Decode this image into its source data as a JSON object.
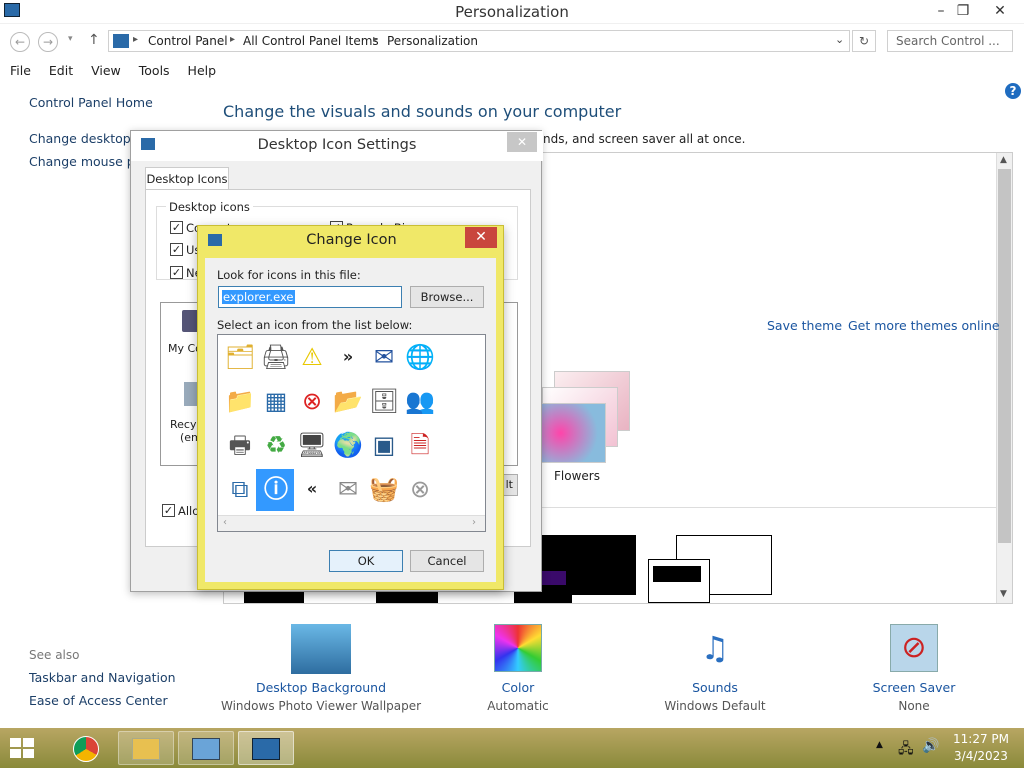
{
  "window": {
    "title": "Personalization"
  },
  "address": {
    "crumbs": [
      "Control Panel",
      "All Control Panel Items",
      "Personalization"
    ],
    "search_placeholder": "Search Control ..."
  },
  "menu": [
    "File",
    "Edit",
    "View",
    "Tools",
    "Help"
  ],
  "left_nav": {
    "home": "Control Panel Home",
    "desktop_icons": "Change desktop icons",
    "mouse_pointers": "Change mouse pointers",
    "see_also": "See also",
    "taskbar": "Taskbar and Navigation",
    "ease": "Ease of Access Center"
  },
  "main": {
    "heading": "Change the visuals and sounds on your computer",
    "subtext": "nds, and screen saver all at once.",
    "save_theme": "Save theme",
    "get_more": "Get more themes online",
    "flowers": "Flowers"
  },
  "bottom": [
    {
      "label": "Desktop Background",
      "value": "Windows Photo Viewer Wallpaper"
    },
    {
      "label": "Color",
      "value": "Automatic"
    },
    {
      "label": "Sounds",
      "value": "Windows Default"
    },
    {
      "label": "Screen Saver",
      "value": "None"
    }
  ],
  "dis": {
    "title": "Desktop Icon Settings",
    "tab": "Desktop Icons",
    "group": "Desktop icons",
    "computer": "Computer",
    "recycle": "Recycle Bin",
    "user": "Use",
    "network": "Ne",
    "mycomp": "My Com",
    "recycle_empty": "Recyc",
    "empty": "(em",
    "allow": "Allow"
  },
  "ci": {
    "title": "Change Icon",
    "look_label": "Look for icons in this file:",
    "file_value": "explorer.exe",
    "browse": "Browse...",
    "select_label": "Select an icon from the list below:",
    "ok": "OK",
    "cancel": "Cancel"
  },
  "clock": {
    "time": "11:27 PM",
    "date": "3/4/2023"
  }
}
